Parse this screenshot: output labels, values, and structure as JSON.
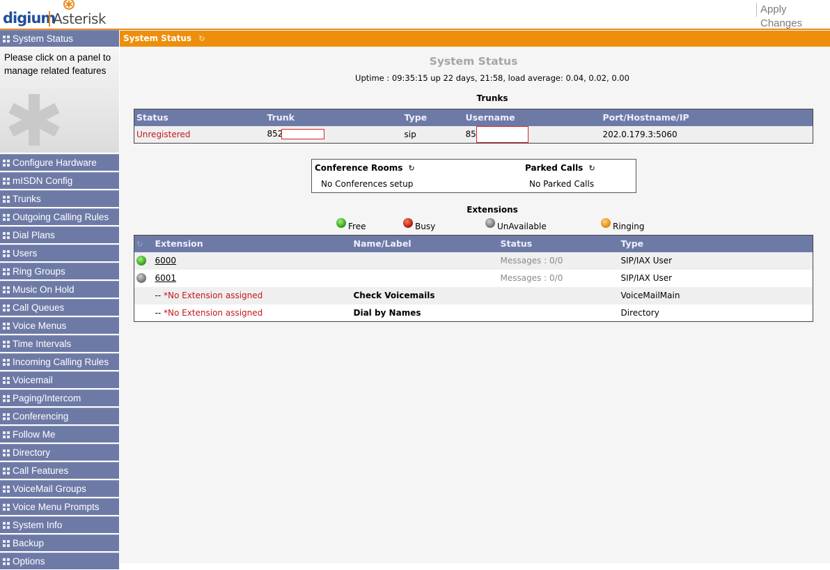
{
  "header": {
    "logo_digium": "digium",
    "logo_asterisk": "Asterisk",
    "apply_changes": "Apply Changes"
  },
  "sidebar": {
    "intro_text": "Please click on a panel to manage related features",
    "items": [
      {
        "label": "System Status"
      },
      {
        "label": "Configure Hardware"
      },
      {
        "label": "mISDN Config"
      },
      {
        "label": "Trunks"
      },
      {
        "label": "Outgoing Calling Rules"
      },
      {
        "label": "Dial Plans"
      },
      {
        "label": "Users"
      },
      {
        "label": "Ring Groups"
      },
      {
        "label": "Music On Hold"
      },
      {
        "label": "Call Queues"
      },
      {
        "label": "Voice Menus"
      },
      {
        "label": "Time Intervals"
      },
      {
        "label": "Incoming Calling Rules"
      },
      {
        "label": "Voicemail"
      },
      {
        "label": "Paging/Intercom"
      },
      {
        "label": "Conferencing"
      },
      {
        "label": "Follow Me"
      },
      {
        "label": "Directory"
      },
      {
        "label": "Call Features"
      },
      {
        "label": "VoiceMail Groups"
      },
      {
        "label": "Voice Menu Prompts"
      },
      {
        "label": "System Info"
      },
      {
        "label": "Backup"
      },
      {
        "label": "Options"
      }
    ]
  },
  "main": {
    "bar_title": "System Status",
    "page_title": "System Status",
    "uptime": "Uptime : 09:35:15 up 22 days, 21:58, load average: 0.04, 0.02, 0.00",
    "trunks": {
      "title": "Trunks",
      "headers": [
        "Status",
        "Trunk",
        "Type",
        "Username",
        "Port/Hostname/IP"
      ],
      "row": {
        "status": "Unregistered",
        "trunk": "852",
        "type": "sip",
        "username": "85",
        "host": "202.0.179.3:5060"
      }
    },
    "conference": {
      "rooms_label": "Conference Rooms",
      "rooms_value": "No Conferences setup",
      "parked_label": "Parked Calls",
      "parked_value": "No Parked Calls"
    },
    "extensions": {
      "title": "Extensions",
      "legend": {
        "free": "Free",
        "busy": "Busy",
        "unavailable": "UnAvailable",
        "ringing": "Ringing"
      },
      "headers": [
        "Extension",
        "Name/Label",
        "Status",
        "Type"
      ],
      "rows": [
        {
          "state": "free",
          "ext": "6000",
          "name": "",
          "status": "Messages : 0/0",
          "type": "SIP/IAX User"
        },
        {
          "state": "unavailable",
          "ext": "6001",
          "name": "",
          "status": "Messages : 0/0",
          "type": "SIP/IAX User"
        },
        {
          "prefix": "-- ",
          "ext": "*No Extension assigned",
          "name": "Check Voicemails",
          "status": "",
          "type": "VoiceMailMain"
        },
        {
          "prefix": "-- ",
          "ext": "*No Extension assigned",
          "name": "Dial by Names",
          "status": "",
          "type": "Directory"
        }
      ]
    }
  },
  "colors": {
    "orange_accent": "#ed8f0c",
    "nav_blue": "#6e7aa6",
    "status_red": "#c4161c"
  }
}
